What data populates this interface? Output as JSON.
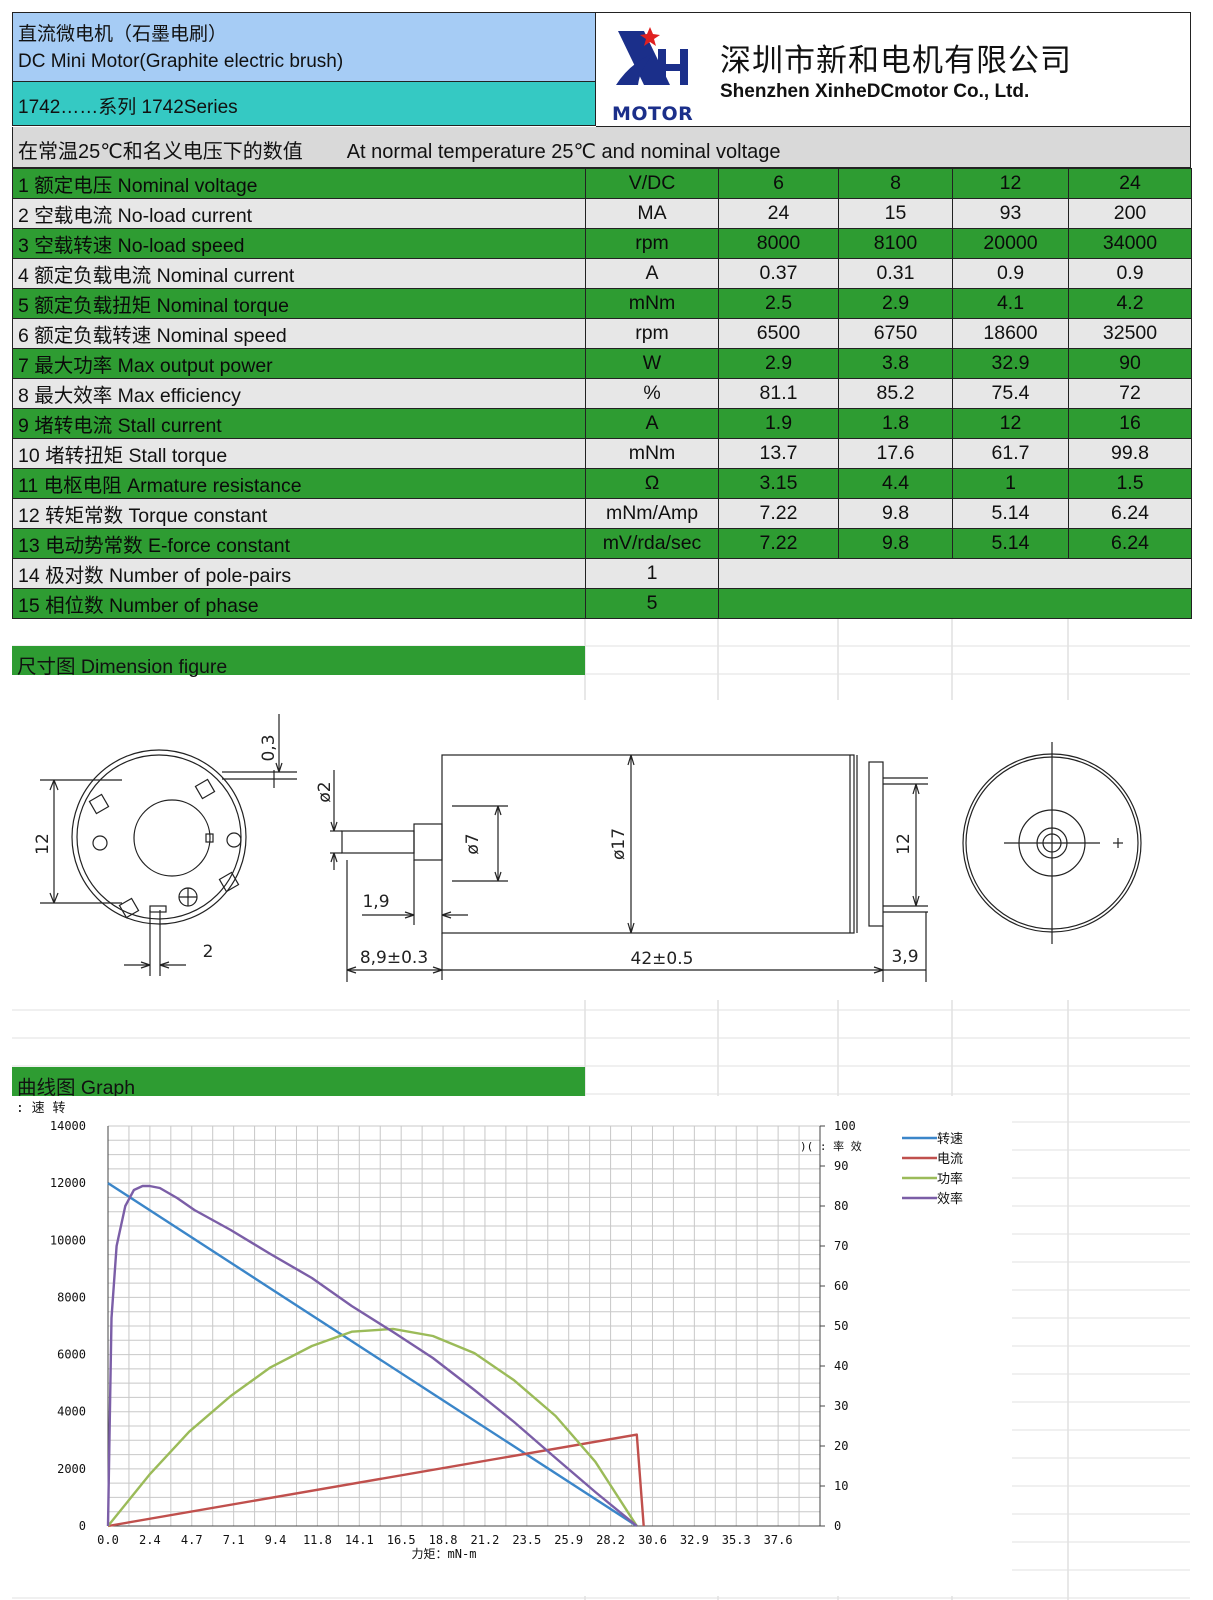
{
  "header": {
    "title_cn": "直流微电机（石墨电刷）",
    "title_en": "DC Mini Motor(Graphite electric brush)",
    "series": "1742……系列  1742Series",
    "logo_text": "MOTOR",
    "company_cn": "深圳市新和电机有限公司",
    "company_en": "Shenzhen XinheDCmotor Co., Ltd."
  },
  "conditions": {
    "cn": "在常温25℃和名义电压下的数值",
    "en": "At normal temperature 25℃ and nominal voltage"
  },
  "spec_rows": [
    {
      "label": "1  额定电压 Nominal voltage",
      "unit": "V/DC",
      "values": [
        "6",
        "8",
        "12",
        "24"
      ]
    },
    {
      "label": "2  空载电流 No-load current",
      "unit": "MA",
      "values": [
        "24",
        "15",
        "93",
        "200"
      ]
    },
    {
      "label": "3  空载转速 No-load speed",
      "unit": "rpm",
      "values": [
        "8000",
        "8100",
        "20000",
        "34000"
      ]
    },
    {
      "label": "4  额定负载电流 Nominal current",
      "unit": "A",
      "values": [
        "0.37",
        "0.31",
        "0.9",
        "0.9"
      ]
    },
    {
      "label": "5  额定负载扭矩 Nominal torque",
      "unit": "mNm",
      "values": [
        "2.5",
        "2.9",
        "4.1",
        "4.2"
      ]
    },
    {
      "label": "6  额定负载转速 Nominal speed",
      "unit": "rpm",
      "values": [
        "6500",
        "6750",
        "18600",
        "32500"
      ]
    },
    {
      "label": "7  最大功率 Max output power",
      "unit": "W",
      "values": [
        "2.9",
        "3.8",
        "32.9",
        "90"
      ]
    },
    {
      "label": "8  最大效率 Max efficiency",
      "unit": "%",
      "values": [
        "81.1",
        "85.2",
        "75.4",
        "72"
      ]
    },
    {
      "label": "9  堵转电流 Stall current",
      "unit": "A",
      "values": [
        "1.9",
        "1.8",
        "12",
        "16"
      ]
    },
    {
      "label": "10  堵转扭矩 Stall torque",
      "unit": "mNm",
      "values": [
        "13.7",
        "17.6",
        "61.7",
        "99.8"
      ]
    },
    {
      "label": "11 电枢电阻 Armature resistance",
      "unit": "Ω",
      "values": [
        "3.15",
        "4.4",
        "1",
        "1.5"
      ]
    },
    {
      "label": "12 转矩常数 Torque constant",
      "unit": "mNm/Amp",
      "values": [
        "7.22",
        "9.8",
        "5.14",
        "6.24"
      ]
    },
    {
      "label": "13 电动势常数  E-force constant",
      "unit": "mV/rda/sec",
      "values": [
        "7.22",
        "9.8",
        "5.14",
        "6.24"
      ]
    },
    {
      "label": "14 极对数 Number of pole-pairs",
      "unit": "1",
      "values": []
    },
    {
      "label": "15 相位数  Number of phase",
      "unit": "5",
      "values": []
    }
  ],
  "sections": {
    "dimension": "尺寸图 Dimension figure",
    "graph": "曲线图 Graph"
  },
  "dimensions": {
    "d03": "0,3",
    "d12_front": "12",
    "d2_slot": "2",
    "d2_shaft": "ø2",
    "d7": "ø7",
    "d17": "ø17",
    "d12_side": "12",
    "d19": "1,9",
    "d89": "8,9±0.3",
    "d42": "42±0.5",
    "d39": "3,9"
  },
  "chart_data": {
    "type": "line",
    "left_axis_title": ": 速 转",
    "right_axis_title": ")( : 率 效",
    "xlabel": "力矩：mN-m",
    "x_ticks": [
      "0.0",
      "2.4",
      "4.7",
      "7.1",
      "9.4",
      "11.8",
      "14.1",
      "16.5",
      "18.8",
      "21.2",
      "23.5",
      "25.9",
      "28.2",
      "30.6",
      "32.9",
      "35.3",
      "37.6"
    ],
    "ylim": [
      0,
      14000
    ],
    "y_ticks": [
      "0",
      "2000",
      "4000",
      "6000",
      "8000",
      "10000",
      "12000",
      "14000"
    ],
    "y2lim": [
      0,
      100
    ],
    "y2_ticks": [
      "0",
      "10",
      "20",
      "30",
      "40",
      "50",
      "60",
      "70",
      "80",
      "90",
      "100"
    ],
    "xlim": [
      0,
      41.2
    ],
    "series": [
      {
        "name": "转速",
        "color": "#3b86c9",
        "axis": "left",
        "x": [
          0,
          30.6
        ],
        "y": [
          12000,
          0
        ]
      },
      {
        "name": "电流",
        "color": "#c0504d",
        "axis": "left",
        "x": [
          0,
          30.6,
          31.0
        ],
        "y": [
          0,
          3200,
          0
        ]
      },
      {
        "name": "功率",
        "color": "#9bbb59",
        "axis": "left",
        "x": [
          0,
          2.4,
          4.7,
          7.1,
          9.4,
          11.8,
          14.1,
          16.5,
          18.8,
          21.2,
          23.5,
          25.9,
          28.2,
          30.6
        ],
        "y": [
          0,
          1800,
          3300,
          4550,
          5550,
          6300,
          6800,
          6900,
          6650,
          6050,
          5100,
          3850,
          2250,
          0
        ]
      },
      {
        "name": "效率",
        "color": "#7b5ea7",
        "axis": "right",
        "x": [
          0,
          0.2,
          0.5,
          1.0,
          1.5,
          2.0,
          2.4,
          3.0,
          4.0,
          5.0,
          7.1,
          9.4,
          11.8,
          14.1,
          16.5,
          18.8,
          21.2,
          23.5,
          25.9,
          28.2,
          30.6
        ],
        "y": [
          0,
          52,
          70,
          80,
          84,
          85,
          85,
          84.5,
          82,
          79,
          74,
          68,
          62,
          55,
          48.5,
          42,
          34,
          26,
          17,
          8.5,
          0
        ]
      }
    ],
    "legend_position": "top-right",
    "grid": true
  }
}
